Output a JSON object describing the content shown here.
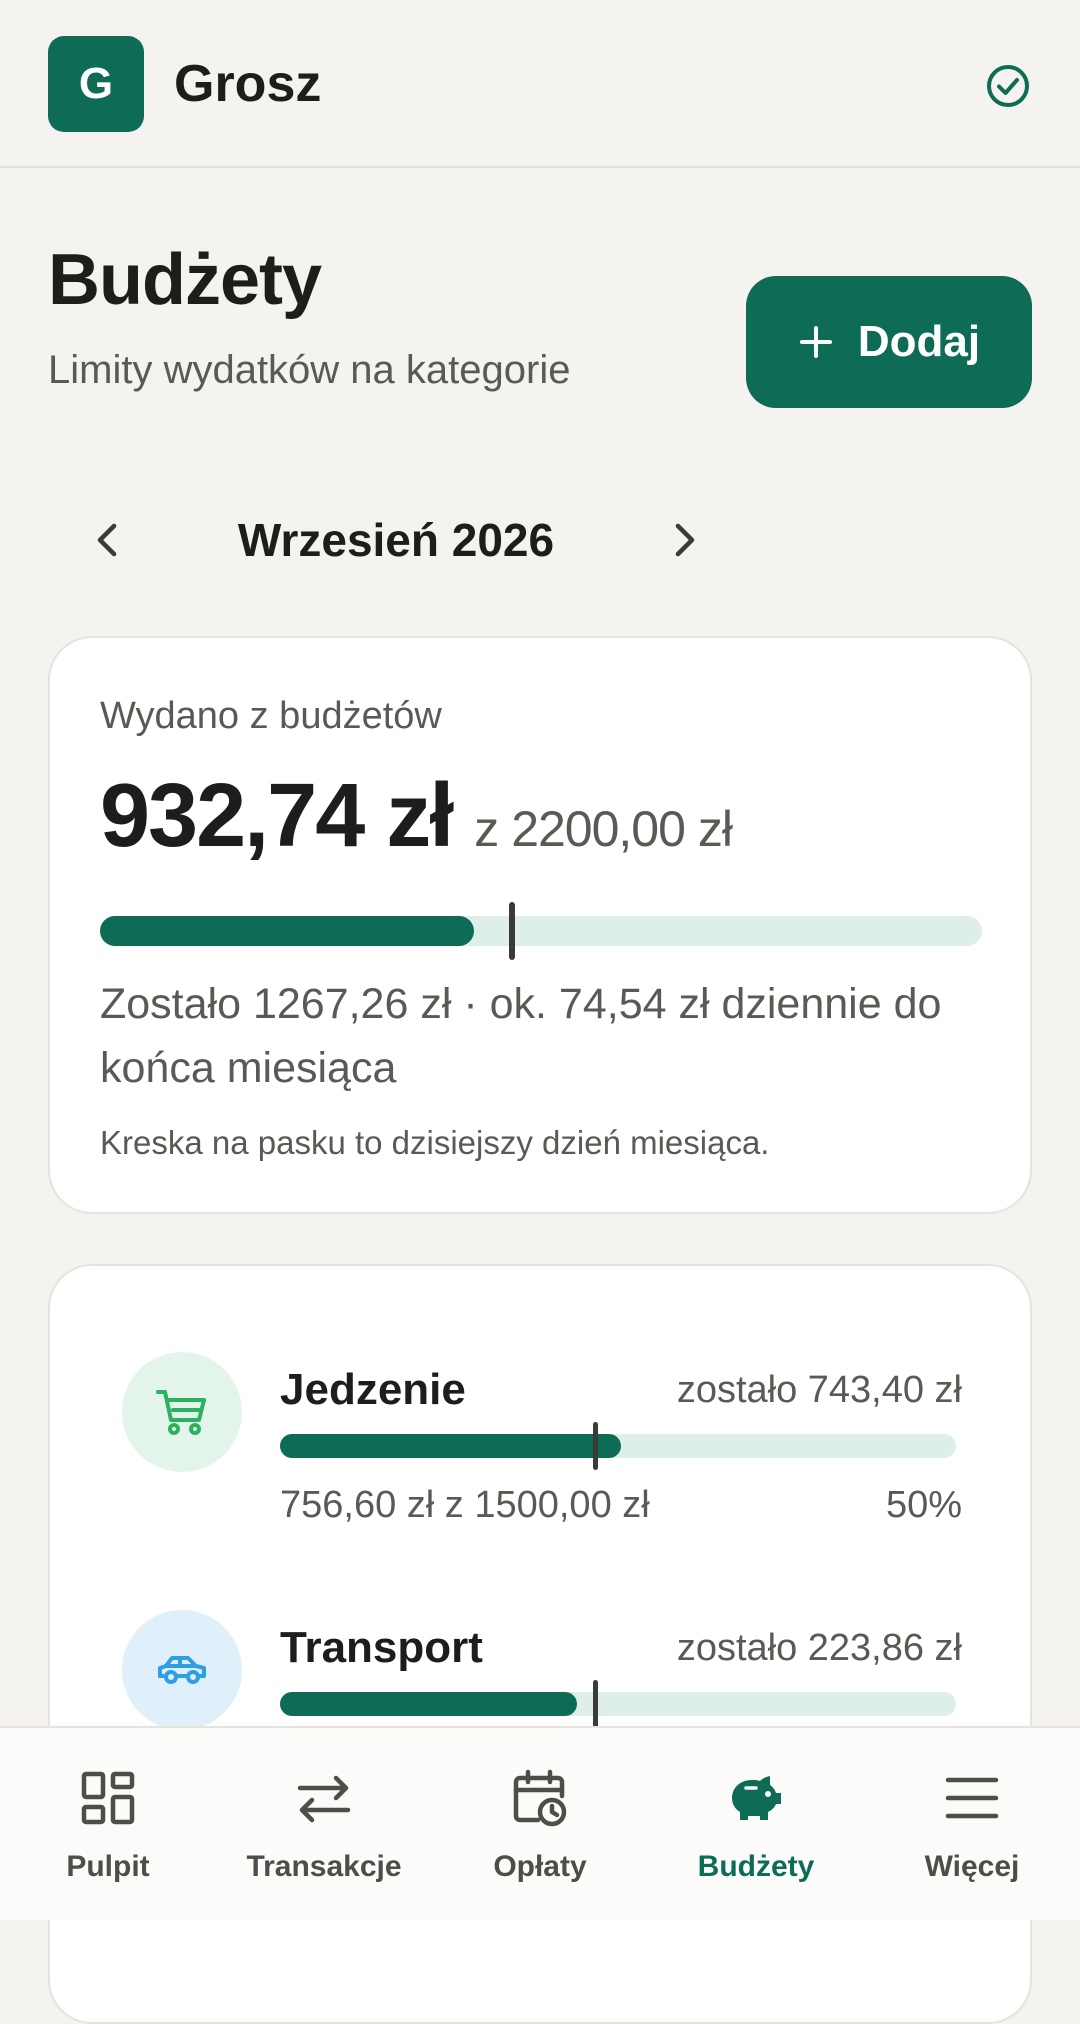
{
  "app": {
    "logo_letter": "G",
    "name": "Grosz",
    "sync_icon": "check-circle-icon"
  },
  "page": {
    "title": "Budżety",
    "subtitle": "Limity wydatków na kategorie",
    "add_button_label": "Dodaj"
  },
  "month": {
    "label": "Wrzesień 2026",
    "prev_icon": "chevron-left-icon",
    "next_icon": "chevron-right-icon"
  },
  "summary": {
    "label": "Wydano z budżetów",
    "spent": "932,74 zł",
    "total": "z 2200,00 zł",
    "progress_fraction": 0.424,
    "today_fraction": 0.467,
    "remaining_text": "Zostało 1267,26 zł · ok. 74,54 zł dziennie do końca miesiąca",
    "note": "Kreska na pasku to dzisiejszy dzień miesiąca."
  },
  "categories": [
    {
      "name": "Jedzenie",
      "icon": "cart-icon",
      "remaining": "zostało 743,40 zł",
      "spent_text": "756,60 zł z 1500,00 zł",
      "percent": "50%",
      "progress_fraction": 0.504,
      "today_fraction": 0.467,
      "icon_bg": "#e3f5ea",
      "icon_color": "#2cb25f"
    },
    {
      "name": "Transport",
      "icon": "car-icon",
      "remaining": "zostało 223,86 zł",
      "spent_text": "",
      "percent": "",
      "progress_fraction": 0.44,
      "today_fraction": 0.467,
      "icon_bg": "#dff0fb",
      "icon_color": "#2e9ee6"
    }
  ],
  "nav": {
    "items": [
      {
        "label": "Pulpit",
        "icon": "dashboard-icon",
        "active": false
      },
      {
        "label": "Transakcje",
        "icon": "swap-arrows-icon",
        "active": false
      },
      {
        "label": "Opłaty",
        "icon": "calendar-clock-icon",
        "active": false
      },
      {
        "label": "Budżety",
        "icon": "piggy-bank-icon",
        "active": true
      },
      {
        "label": "Więcej",
        "icon": "menu-icon",
        "active": false
      }
    ]
  },
  "colors": {
    "accent": "#0e6b55",
    "track": "#ddefe8",
    "background": "#f4f3ef"
  }
}
